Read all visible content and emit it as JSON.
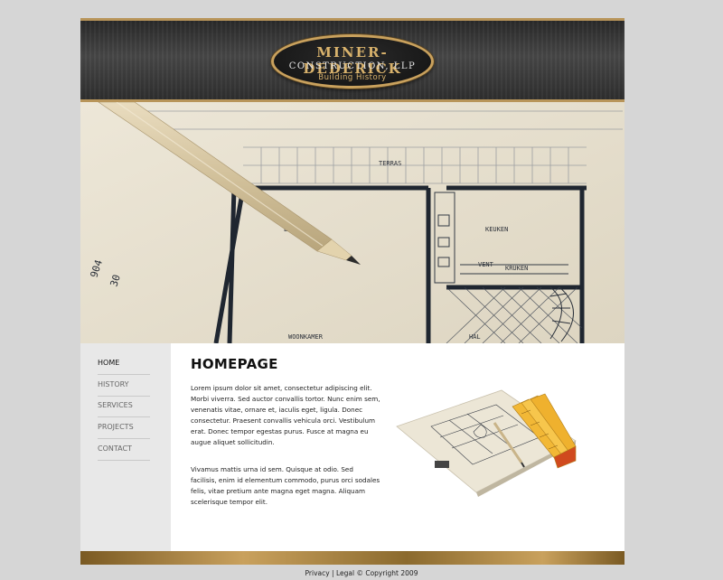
{
  "header": {
    "logo_line1": "MINER-DEDERICK",
    "logo_line2": "CONSTRUCTION, LLP",
    "logo_line3": "Building History"
  },
  "hero": {
    "labels": [
      "EETKAMER",
      "KEUKEN",
      "TERRAS",
      "WOONKAMER",
      "HAL",
      "KRUKEN",
      "VENT"
    ],
    "dims": [
      "904",
      "30"
    ]
  },
  "nav": {
    "items": [
      {
        "label": "HOME"
      },
      {
        "label": "HISTORY"
      },
      {
        "label": "SERVICES"
      },
      {
        "label": "PROJECTS"
      },
      {
        "label": "CONTACT"
      }
    ]
  },
  "main": {
    "title": "HOMEPAGE",
    "paragraph1": "Lorem ipsum dolor sit amet, consectetur adipiscing elit. Morbi viverra. Sed auctor convallis tortor. Nunc enim sem, venenatis vitae, ornare et, iaculis eget, ligula. Donec consectetur. Praesent convallis vehicula orci. Vestibulum erat. Donec tempor egestas purus. Fusce at magna eu augue aliquet sollicitudin.",
    "paragraph2": "Vivamus mattis urna id sem. Quisque at odio. Sed facilisis, enim id elementum commodo, purus orci sodales felis, vitae pretium ante magna eget magna. Aliquam scelerisque tempor elit."
  },
  "footer": {
    "privacy": "Privacy",
    "sep": " | ",
    "legal": "Legal",
    "copyright": " © Copyright 2009"
  },
  "colors": {
    "gold": "#c9a15d",
    "header_dark": "#2f2f2f",
    "page_bg": "#d6d6d6",
    "sidebar_bg": "#e8e8e8"
  }
}
